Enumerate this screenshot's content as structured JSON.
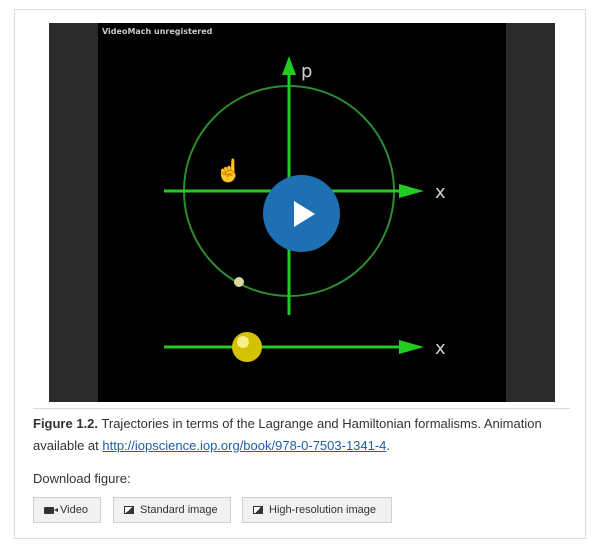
{
  "video": {
    "watermark": "VideoMach unregistered",
    "axis_p": "p",
    "axis_x_top": "x",
    "axis_x_bottom": "x"
  },
  "caption": {
    "figure_label": "Figure 1.2.",
    "text": " Trajectories in terms of the Lagrange and Hamiltonian formalisms. Animation available at ",
    "link": "http://iopscience.iop.org/book/978-0-7503-1341-4",
    "end": "."
  },
  "download": {
    "label": "Download figure:",
    "buttons": [
      {
        "label": "Video",
        "icon": "video-camera-icon"
      },
      {
        "label": "Standard image",
        "icon": "image-icon"
      },
      {
        "label": "High-resolution image",
        "icon": "image-icon"
      }
    ]
  }
}
